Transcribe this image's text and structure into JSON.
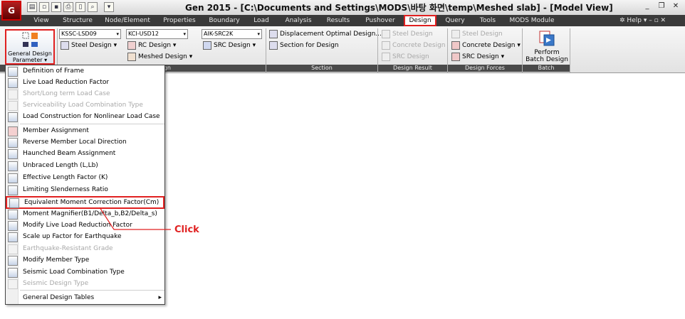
{
  "titlebar": {
    "title": "Gen 2015 - [C:\\Documents and Settings\\MODS\\바탕 화면\\temp\\Meshed slab] - [Model View]",
    "logo_text": "G",
    "window_buttons": [
      "_",
      "❐",
      "✕"
    ]
  },
  "menubar": {
    "items": [
      "View",
      "Structure",
      "Node/Element",
      "Properties",
      "Boundary",
      "Load",
      "Analysis",
      "Results",
      "Pushover",
      "Design",
      "Query",
      "Tools",
      "MODS Module"
    ],
    "active": "Design",
    "help": "Help"
  },
  "ribbon": {
    "general_design": {
      "line1": "General Design",
      "line2": "Parameter ▾"
    },
    "combos": {
      "steel_code": "KSSC-LSD09",
      "rc_code": "KCI-USD12",
      "src_code": "AIK-SRC2K"
    },
    "design_buttons": {
      "steel_design": "Steel Design ▾",
      "rc_design": "RC Design ▾",
      "meshed_design": "Meshed Design ▾",
      "src_design": "SRC Design ▾"
    },
    "section": {
      "displacement": "Displacement Optimal Design...",
      "section_for_design": "Section for Design",
      "label": "Section"
    },
    "design_result": {
      "steel": "Steel Design",
      "concrete": "Concrete Design",
      "src": "SRC Design",
      "label": "Design Result"
    },
    "design_forces": {
      "steel": "Steel Design",
      "concrete": "Concrete Design ▾",
      "src": "SRC Design ▾",
      "label": "Design Forces"
    },
    "batch": {
      "line1": "Perform",
      "line2": "Batch Design",
      "label": "Batch"
    },
    "design_panel_label": "gn"
  },
  "dropdown": {
    "items": [
      {
        "label": "Definition of Frame",
        "enabled": true
      },
      {
        "label": "Live Load Reduction Factor",
        "enabled": true
      },
      {
        "label": "Short/Long term Load Case",
        "enabled": false
      },
      {
        "label": "Serviceability Load Combination Type",
        "enabled": false
      },
      {
        "label": "Load Construction for Nonlinear Load Case",
        "enabled": true
      },
      {
        "label": "Member Assignment",
        "enabled": true
      },
      {
        "label": "Reverse Member Local Direction",
        "enabled": true
      },
      {
        "label": "Haunched Beam Assignment",
        "enabled": true
      },
      {
        "label": "Unbraced Length (L,Lb)",
        "enabled": true
      },
      {
        "label": "Effective Length Factor (K)",
        "enabled": true
      },
      {
        "label": "Limiting Slenderness Ratio",
        "enabled": true
      },
      {
        "label": "Equivalent Moment Correction Factor(Cm)",
        "enabled": true
      },
      {
        "label": "Moment Magnifier(B1/Delta_b,B2/Delta_s)",
        "enabled": true
      },
      {
        "label": "Modify Live Load Reduction Factor",
        "enabled": true
      },
      {
        "label": "Scale up Factor for Earthquake",
        "enabled": true
      },
      {
        "label": "Earthquake-Resistant Grade",
        "enabled": false
      },
      {
        "label": "Modify Member Type",
        "enabled": true
      },
      {
        "label": "Seismic Load Combination Type",
        "enabled": true
      },
      {
        "label": "Seismic Design Type",
        "enabled": false
      },
      {
        "label": "General Design Tables",
        "enabled": true
      }
    ]
  },
  "annotation": {
    "text": "Click",
    "color": "#e02020"
  }
}
